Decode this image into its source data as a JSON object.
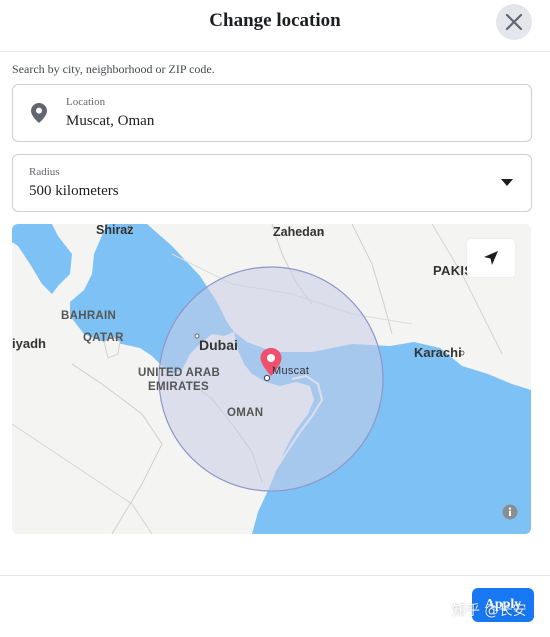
{
  "dialog": {
    "title": "Change location",
    "close_label": "Close"
  },
  "search": {
    "hint": "Search by city, neighborhood or ZIP code."
  },
  "location": {
    "label": "Location",
    "value": "Muscat, Oman"
  },
  "radius": {
    "label": "Radius",
    "value": "500 kilometers"
  },
  "map": {
    "labels": {
      "shiraz": "Shiraz",
      "zahedan": "Zahedan",
      "pakistan": "PAKIS",
      "bahrain": "BAHRAIN",
      "qatar": "QATAR",
      "riyadh": "iyadh",
      "dubai": "Dubai",
      "muscat": "Muscat",
      "uae_line1": "UNITED ARAB",
      "uae_line2": "EMIRATES",
      "karachi": "Karachi",
      "oman": "OMAN"
    },
    "colors": {
      "water": "#7ec1f5",
      "land": "#f4f4f2",
      "radius_fill": "#c9cde6",
      "marker": "#f0506e"
    }
  },
  "footer": {
    "apply_label": "Apply",
    "watermark": "知乎 @长安"
  },
  "colors": {
    "primary": "#1877f2"
  }
}
